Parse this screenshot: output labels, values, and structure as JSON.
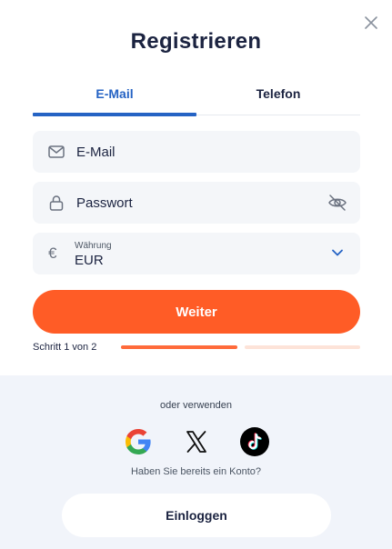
{
  "dialog": {
    "title": "Registrieren"
  },
  "tabs": [
    {
      "label": "E-Mail",
      "active": true
    },
    {
      "label": "Telefon",
      "active": false
    }
  ],
  "form": {
    "email_placeholder": "E-Mail",
    "password_placeholder": "Passwort",
    "currency_label": "Währung",
    "currency_value": "EUR",
    "currency_symbol": "€",
    "submit_label": "Weiter"
  },
  "progress": {
    "step_text": "Schritt 1 von 2",
    "current_step": 1,
    "total_steps": 2
  },
  "alt_login": {
    "or_text": "oder verwenden",
    "providers": [
      "google-icon",
      "x-icon",
      "tiktok-icon"
    ],
    "have_account_text": "Haben Sie bereits ein Konto?",
    "login_label": "Einloggen"
  },
  "colors": {
    "accent": "#ff5c26",
    "tab_active": "#2563c4",
    "title": "#1b2340"
  }
}
